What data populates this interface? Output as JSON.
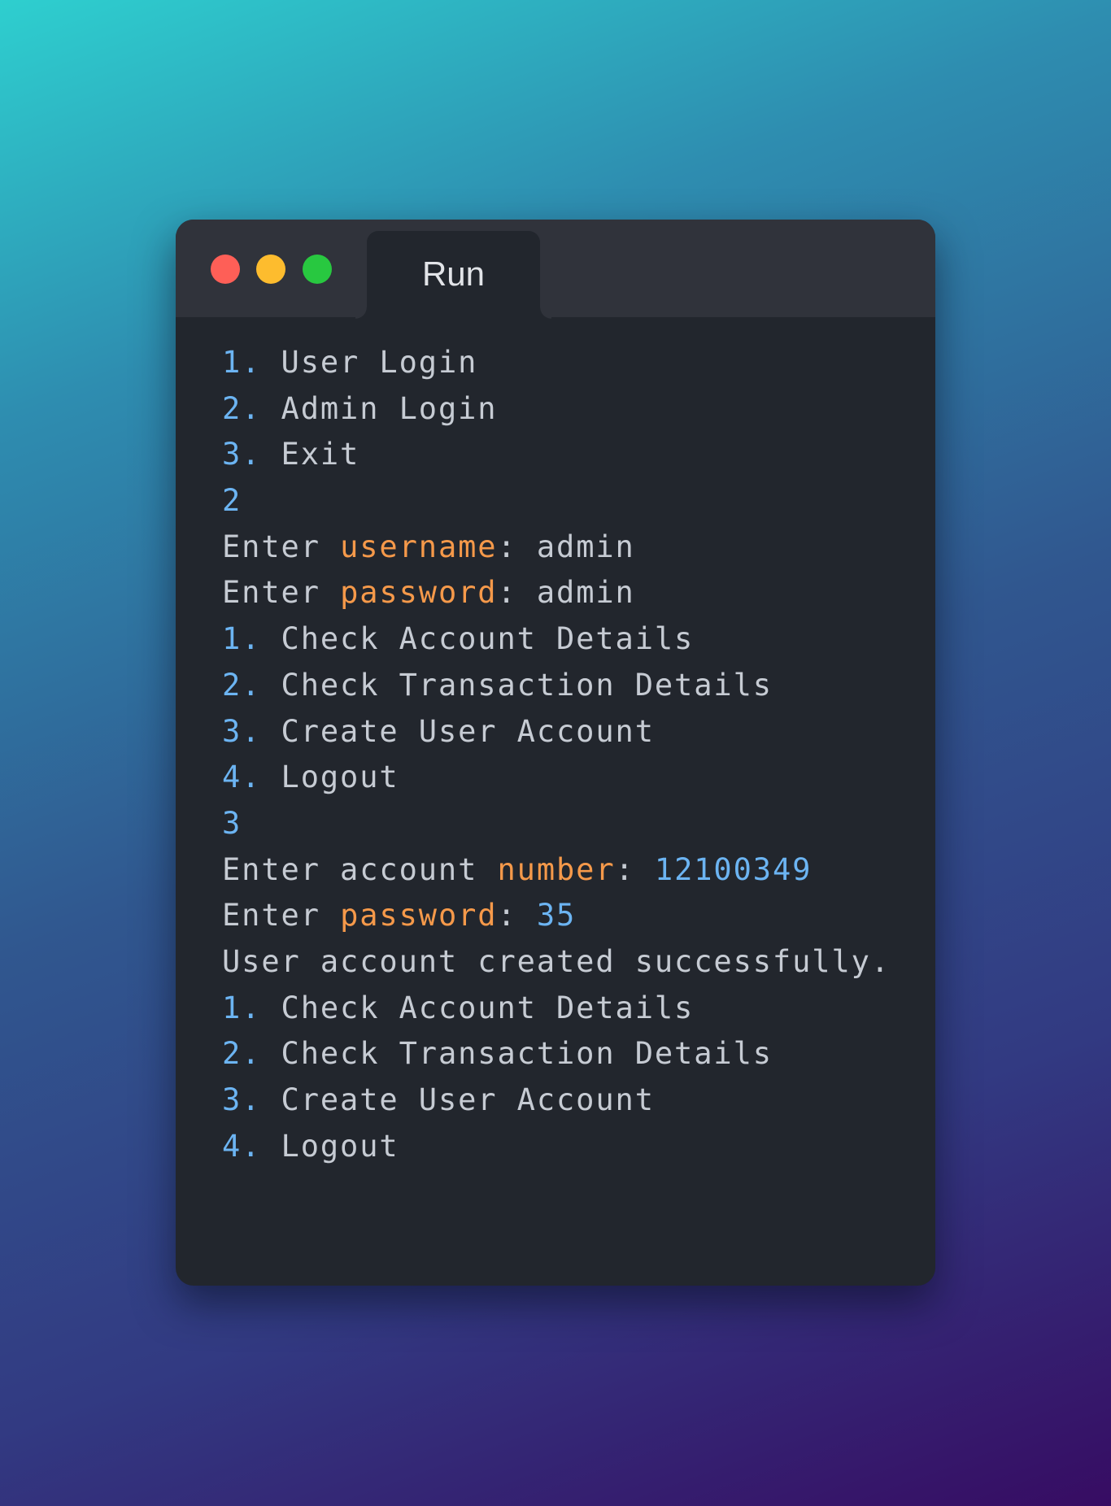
{
  "window": {
    "tab_title": "Run",
    "traffic_lights": {
      "close": "#fe5f57",
      "minimize": "#fdbc2e",
      "maximize": "#28c840"
    }
  },
  "colors": {
    "number": "#6cb4f2",
    "keyword": "#f5994a",
    "text": "#c6cbd3",
    "background": "#22262d"
  },
  "terminal": {
    "lines": [
      [
        {
          "t": "1. ",
          "c": "num"
        },
        {
          "t": "User Login",
          "c": "txt"
        }
      ],
      [
        {
          "t": "2. ",
          "c": "num"
        },
        {
          "t": "Admin Login",
          "c": "txt"
        }
      ],
      [
        {
          "t": "3. ",
          "c": "num"
        },
        {
          "t": "Exit",
          "c": "txt"
        }
      ],
      [
        {
          "t": "2",
          "c": "num"
        }
      ],
      [
        {
          "t": "Enter ",
          "c": "txt"
        },
        {
          "t": "username",
          "c": "kw"
        },
        {
          "t": ": admin",
          "c": "txt"
        }
      ],
      [
        {
          "t": "Enter ",
          "c": "txt"
        },
        {
          "t": "password",
          "c": "kw"
        },
        {
          "t": ": admin",
          "c": "txt"
        }
      ],
      [
        {
          "t": "1. ",
          "c": "num"
        },
        {
          "t": "Check Account Details",
          "c": "txt"
        }
      ],
      [
        {
          "t": "2. ",
          "c": "num"
        },
        {
          "t": "Check Transaction Details",
          "c": "txt"
        }
      ],
      [
        {
          "t": "3. ",
          "c": "num"
        },
        {
          "t": "Create User Account",
          "c": "txt"
        }
      ],
      [
        {
          "t": "4. ",
          "c": "num"
        },
        {
          "t": "Logout",
          "c": "txt"
        }
      ],
      [
        {
          "t": "3",
          "c": "num"
        }
      ],
      [
        {
          "t": "Enter account ",
          "c": "txt"
        },
        {
          "t": "number",
          "c": "kw"
        },
        {
          "t": ": ",
          "c": "txt"
        },
        {
          "t": "12100349",
          "c": "num"
        }
      ],
      [
        {
          "t": "Enter ",
          "c": "txt"
        },
        {
          "t": "password",
          "c": "kw"
        },
        {
          "t": ": ",
          "c": "txt"
        },
        {
          "t": "35",
          "c": "num"
        }
      ],
      [
        {
          "t": "User account created successfully.",
          "c": "txt"
        }
      ],
      [
        {
          "t": "1. ",
          "c": "num"
        },
        {
          "t": "Check Account Details",
          "c": "txt"
        }
      ],
      [
        {
          "t": "2. ",
          "c": "num"
        },
        {
          "t": "Check Transaction Details",
          "c": "txt"
        }
      ],
      [
        {
          "t": "3. ",
          "c": "num"
        },
        {
          "t": "Create User Account",
          "c": "txt"
        }
      ],
      [
        {
          "t": "4. ",
          "c": "num"
        },
        {
          "t": "Logout",
          "c": "txt"
        }
      ]
    ]
  }
}
